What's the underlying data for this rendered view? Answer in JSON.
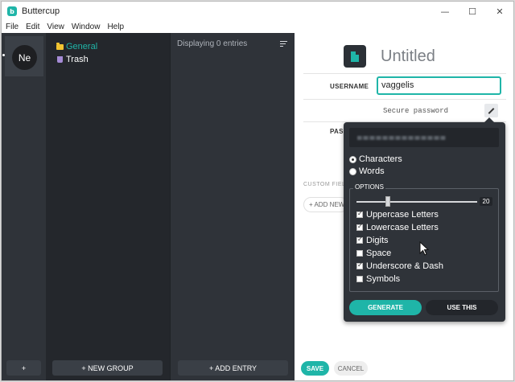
{
  "window": {
    "title": "Buttercup",
    "app_icon_letter": "b",
    "controls": {
      "minimize": "—",
      "maximize": "☐",
      "close": "✕"
    }
  },
  "menu": [
    "File",
    "Edit",
    "View",
    "Window",
    "Help"
  ],
  "accounts": {
    "avatar_initials": "Ne"
  },
  "groups": {
    "items": [
      {
        "label": "General",
        "icon": "folder-icon",
        "color": "#1fb5a8"
      },
      {
        "label": "Trash",
        "icon": "trash-icon",
        "color": "#ffffff"
      }
    ],
    "add_button": "+",
    "new_group_button": "+ NEW GROUP"
  },
  "entries": {
    "header": "Displaying 0 entries",
    "sort_icon": "sort-icon",
    "add_entry_button": "+ ADD ENTRY"
  },
  "editor": {
    "title": "Untitled",
    "username_label": "USERNAME",
    "username_value": "vaggelis",
    "password_label": "PASS",
    "password_placeholder": "Secure password",
    "custom_fields_label": "CUSTOM FIELD",
    "add_new_label": "+ ADD NEW",
    "save_button": "SAVE",
    "cancel_button": "CANCEL"
  },
  "generator": {
    "modes": [
      {
        "label": "Characters",
        "selected": true
      },
      {
        "label": "Words",
        "selected": false
      }
    ],
    "options_label": "OPTIONS",
    "length": "20",
    "length_fraction": 0.25,
    "checks": [
      {
        "label": "Uppercase Letters",
        "checked": true
      },
      {
        "label": "Lowercase Letters",
        "checked": true
      },
      {
        "label": "Digits",
        "checked": true
      },
      {
        "label": "Space",
        "checked": false
      },
      {
        "label": "Underscore & Dash",
        "checked": true
      },
      {
        "label": "Symbols",
        "checked": false
      }
    ],
    "generate_button": "GENERATE",
    "use_button": "USE THIS"
  },
  "colors": {
    "accent": "#1fb5a8",
    "dark": "#2f3339"
  }
}
